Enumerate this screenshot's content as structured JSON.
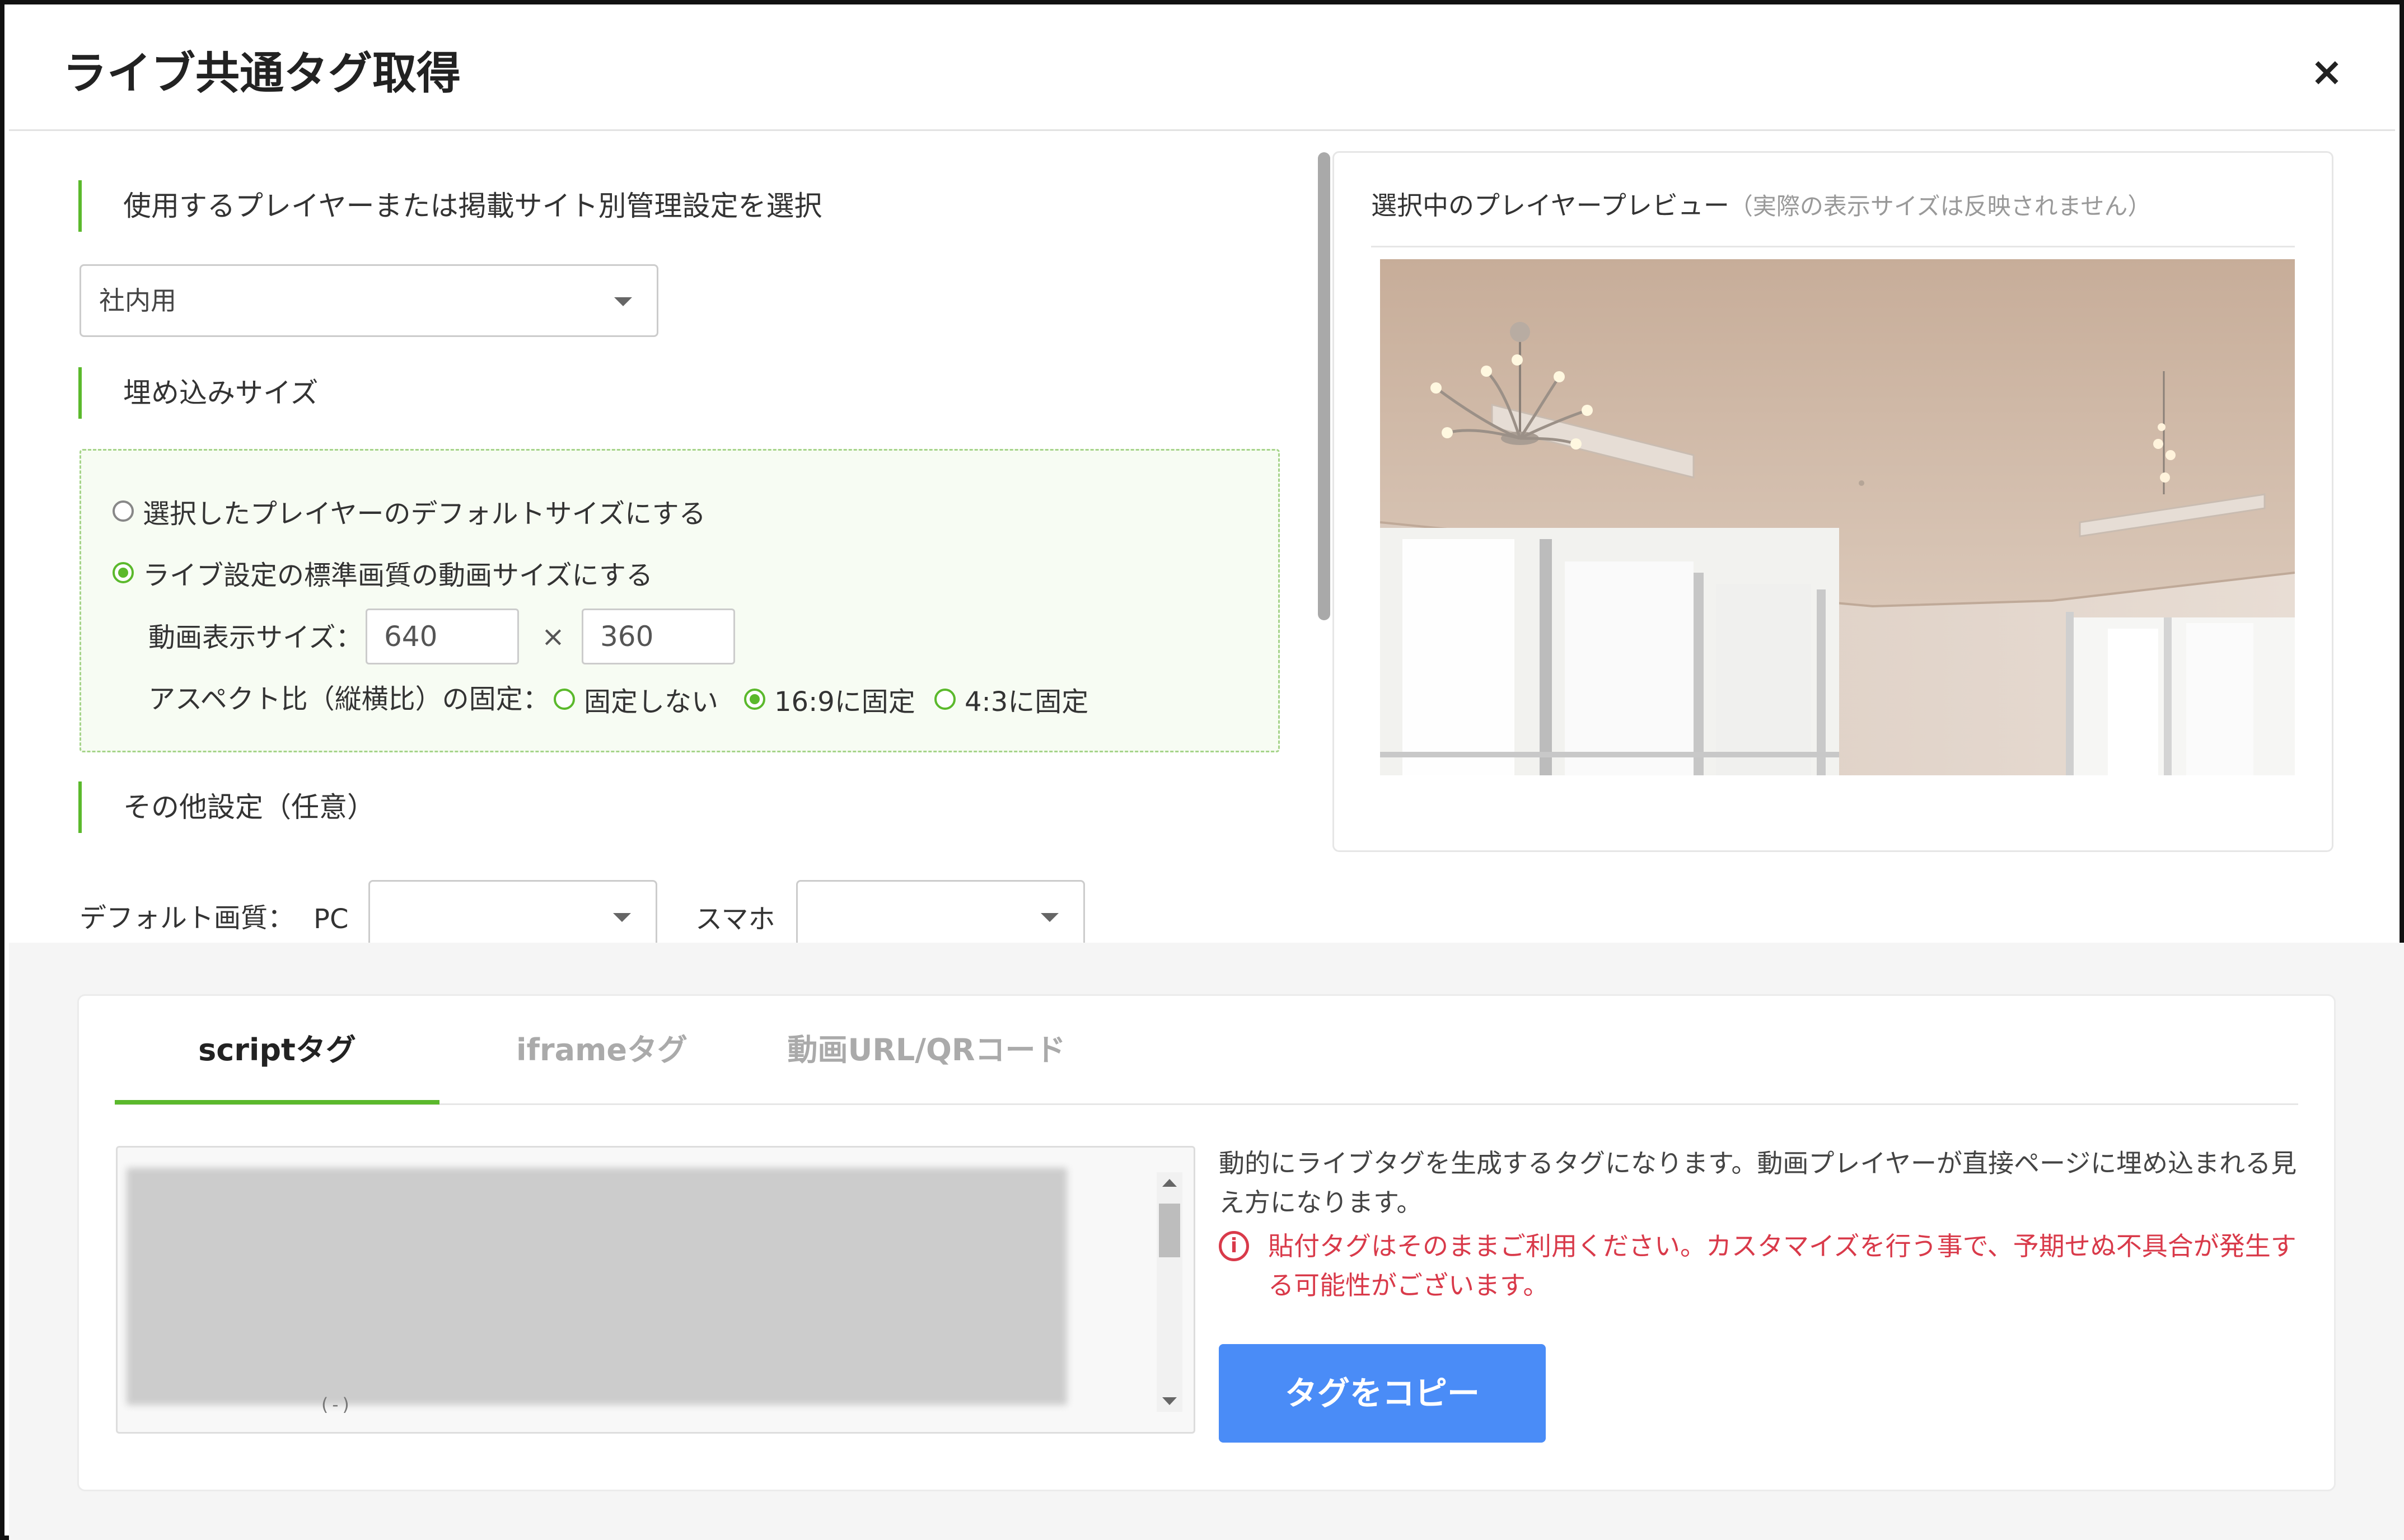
{
  "dialog": {
    "title": "ライブ共通タグ取得",
    "close_label": "×"
  },
  "player_select": {
    "heading": "使用するプレイヤーまたは掲載サイト別管理設定を選択",
    "value": "社内用"
  },
  "embed_size": {
    "heading": "埋め込みサイズ",
    "option_default": "選択したプレイヤーのデフォルトサイズにする",
    "option_live": "ライブ設定の標準画質の動画サイズにする",
    "selected": "option_live",
    "display_size_label": "動画表示サイズ：",
    "width": "640",
    "times": "×",
    "height": "360",
    "aspect_label": "アスペクト比（縦横比）の固定：",
    "aspect_options": [
      "固定しない",
      "16:9に固定",
      "4:3に固定"
    ],
    "aspect_selected_index": 1
  },
  "other_settings": {
    "heading": "その他設定（任意）",
    "default_quality_label": "デフォルト画質：",
    "pc_label": "PC",
    "pc_value": "",
    "smartphone_label": "スマホ",
    "smartphone_value": ""
  },
  "preview": {
    "title": "選択中のプレイヤープレビュー",
    "note": "（実際の表示サイズは反映されません）"
  },
  "tabs": {
    "items": [
      "scriptタグ",
      "iframeタグ",
      "動画URL/QRコード"
    ],
    "active_index": 0
  },
  "script_tab": {
    "code_tail": "(-)",
    "description": "動的にライブタグを生成するタグになります。動画プレイヤーが直接ページに埋め込まれる見え方になります。",
    "warning": "貼付タグはそのままご利用ください。カスタマイズを行う事で、予期せぬ不具合が発生する可能性がございます。",
    "copy_button": "タグをコピー"
  },
  "colors": {
    "accent_green": "#5bb92c",
    "button_blue": "#4a8cf7",
    "warning_red": "#d93a4a"
  }
}
